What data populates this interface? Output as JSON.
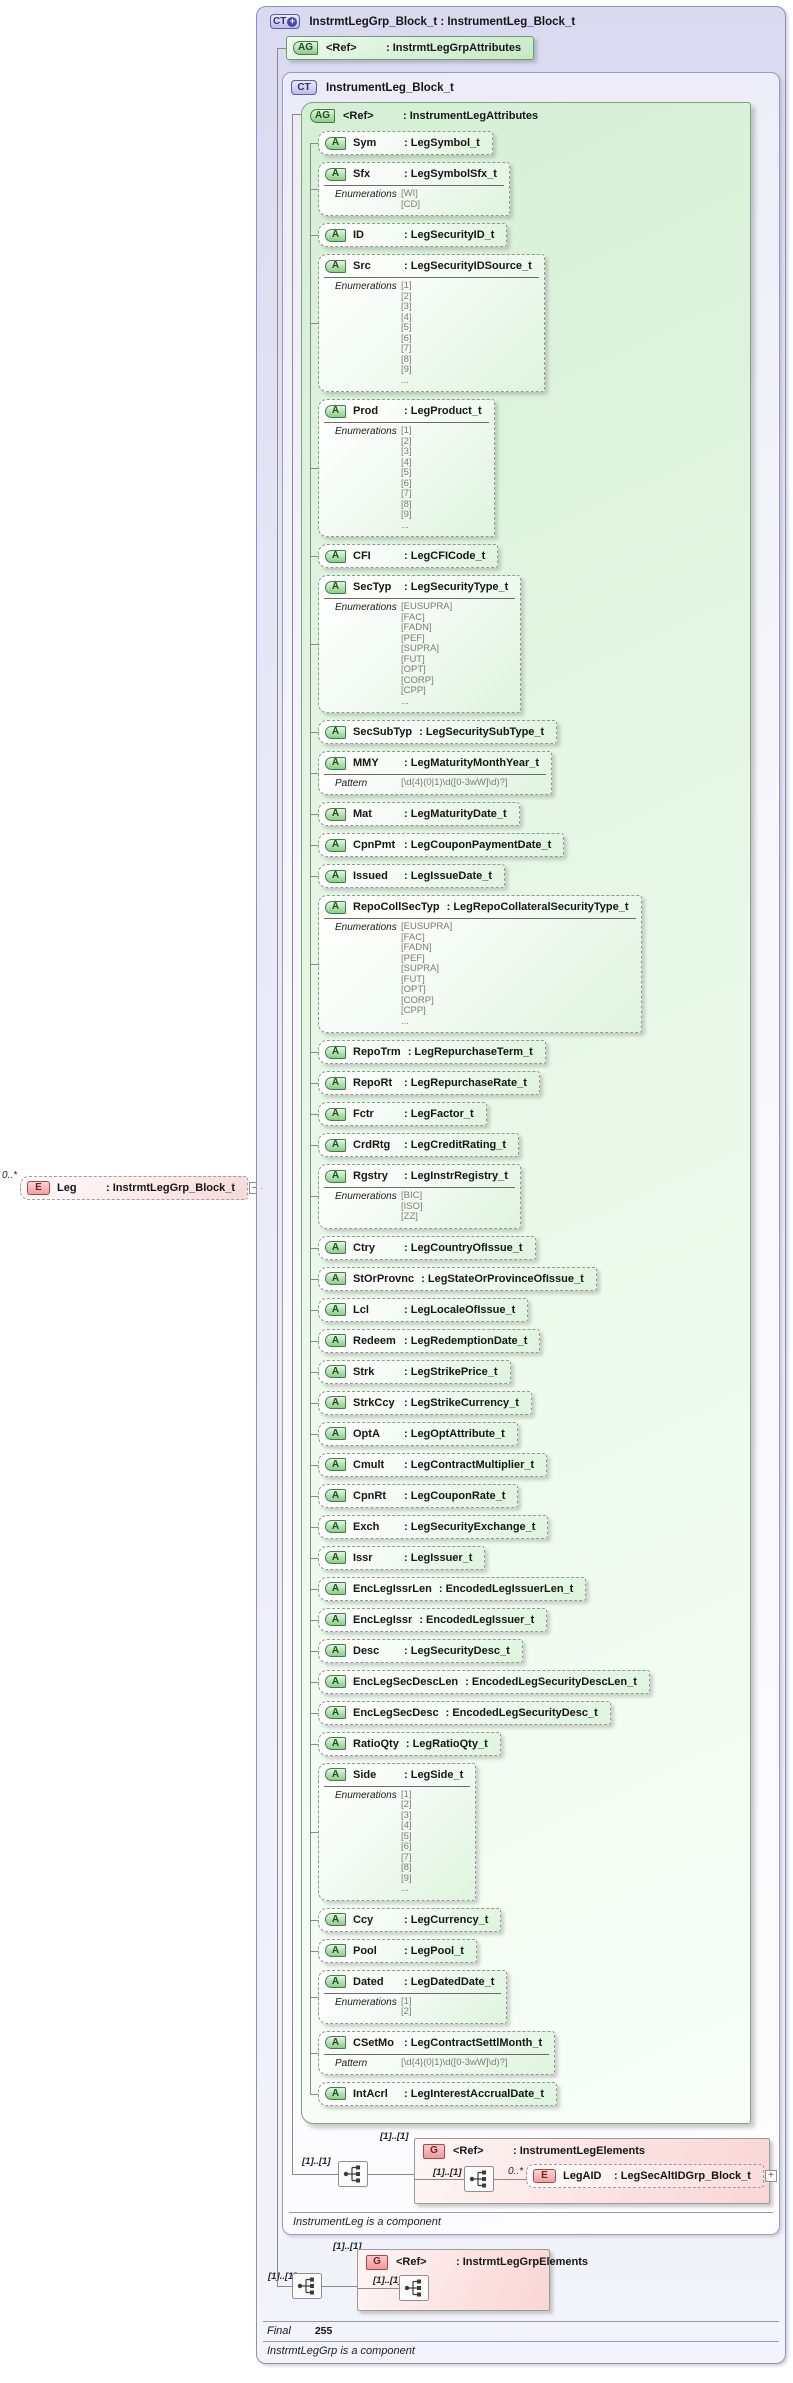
{
  "diagram": {
    "root": {
      "badge": "CT",
      "title": "InstrmtLegGrp_Block_t : InstrumentLeg_Block_t"
    },
    "labels": {
      "enumerations": "Enumerations",
      "pattern": "Pattern"
    },
    "outer_ag": {
      "badge": "AG",
      "ref": "<Ref>",
      "type": ": InstrmtLegGrpAttributes"
    },
    "ct": {
      "badge": "CT",
      "title": "InstrumentLeg_Block_t",
      "footer": "InstrumentLeg is a component"
    },
    "inner_ag": {
      "badge": "AG",
      "ref": "<Ref>",
      "type": ": InstrumentLegAttributes"
    },
    "leg": {
      "cardinality": "0..*",
      "badge": "E",
      "name": "Leg",
      "type": ": InstrmtLegGrp_Block_t",
      "collapse_glyph": "–"
    },
    "attributes": [
      {
        "badge": "A",
        "name": "Sym",
        "type": ": LegSymbol_t"
      },
      {
        "badge": "A",
        "name": "Sfx",
        "type": ": LegSymbolSfx_t",
        "enums": [
          "[WI]",
          "[CD]"
        ]
      },
      {
        "badge": "A",
        "name": "ID",
        "type": ": LegSecurityID_t"
      },
      {
        "badge": "A",
        "name": "Src",
        "type": ": LegSecurityIDSource_t",
        "enums": [
          "[1]",
          "[2]",
          "[3]",
          "[4]",
          "[5]",
          "[6]",
          "[7]",
          "[8]",
          "[9]",
          "..."
        ]
      },
      {
        "badge": "A",
        "name": "Prod",
        "type": ": LegProduct_t",
        "enums": [
          "[1]",
          "[2]",
          "[3]",
          "[4]",
          "[5]",
          "[6]",
          "[7]",
          "[8]",
          "[9]",
          "..."
        ]
      },
      {
        "badge": "A",
        "name": "CFI",
        "type": ": LegCFICode_t"
      },
      {
        "badge": "A",
        "name": "SecTyp",
        "type": ": LegSecurityType_t",
        "enums": [
          "[EUSUPRA]",
          "[FAC]",
          "[FADN]",
          "[PEF]",
          "[SUPRA]",
          "[FUT]",
          "[OPT]",
          "[CORP]",
          "[CPP]",
          "..."
        ]
      },
      {
        "badge": "A",
        "name": "SecSubTyp",
        "type": ": LegSecuritySubType_t"
      },
      {
        "badge": "A",
        "name": "MMY",
        "type": ": LegMaturityMonthYear_t",
        "pattern": "[\\d{4}(0|1)\\d([0-3wW]\\d)?]"
      },
      {
        "badge": "A",
        "name": "Mat",
        "type": ": LegMaturityDate_t"
      },
      {
        "badge": "A",
        "name": "CpnPmt",
        "type": ": LegCouponPaymentDate_t"
      },
      {
        "badge": "A",
        "name": "Issued",
        "type": ": LegIssueDate_t"
      },
      {
        "badge": "A",
        "name": "RepoCollSecTyp",
        "type": ": LegRepoCollateralSecurityType_t",
        "enums": [
          "[EUSUPRA]",
          "[FAC]",
          "[FADN]",
          "[PEF]",
          "[SUPRA]",
          "[FUT]",
          "[OPT]",
          "[CORP]",
          "[CPP]",
          "..."
        ]
      },
      {
        "badge": "A",
        "name": "RepoTrm",
        "type": ": LegRepurchaseTerm_t"
      },
      {
        "badge": "A",
        "name": "RepoRt",
        "type": ": LegRepurchaseRate_t"
      },
      {
        "badge": "A",
        "name": "Fctr",
        "type": ": LegFactor_t"
      },
      {
        "badge": "A",
        "name": "CrdRtg",
        "type": ": LegCreditRating_t"
      },
      {
        "badge": "A",
        "name": "Rgstry",
        "type": ": LegInstrRegistry_t",
        "enums": [
          "[BIC]",
          "[ISO]",
          "[ZZ]"
        ]
      },
      {
        "badge": "A",
        "name": "Ctry",
        "type": ": LegCountryOfIssue_t"
      },
      {
        "badge": "A",
        "name": "StOrProvnc",
        "type": ": LegStateOrProvinceOfIssue_t"
      },
      {
        "badge": "A",
        "name": "Lcl",
        "type": ": LegLocaleOfIssue_t"
      },
      {
        "badge": "A",
        "name": "Redeem",
        "type": ": LegRedemptionDate_t"
      },
      {
        "badge": "A",
        "name": "Strk",
        "type": ": LegStrikePrice_t"
      },
      {
        "badge": "A",
        "name": "StrkCcy",
        "type": ": LegStrikeCurrency_t"
      },
      {
        "badge": "A",
        "name": "OptA",
        "type": ": LegOptAttribute_t"
      },
      {
        "badge": "A",
        "name": "Cmult",
        "type": ": LegContractMultiplier_t"
      },
      {
        "badge": "A",
        "name": "CpnRt",
        "type": ": LegCouponRate_t"
      },
      {
        "badge": "A",
        "name": "Exch",
        "type": ": LegSecurityExchange_t"
      },
      {
        "badge": "A",
        "name": "Issr",
        "type": ": LegIssuer_t"
      },
      {
        "badge": "A",
        "name": "EncLegIssrLen",
        "type": ": EncodedLegIssuerLen_t"
      },
      {
        "badge": "A",
        "name": "EncLegIssr",
        "type": ": EncodedLegIssuer_t"
      },
      {
        "badge": "A",
        "name": "Desc",
        "type": ": LegSecurityDesc_t"
      },
      {
        "badge": "A",
        "name": "EncLegSecDescLen",
        "type": ": EncodedLegSecurityDescLen_t"
      },
      {
        "badge": "A",
        "name": "EncLegSecDesc",
        "type": ": EncodedLegSecurityDesc_t"
      },
      {
        "badge": "A",
        "name": "RatioQty",
        "type": ": LegRatioQty_t"
      },
      {
        "badge": "A",
        "name": "Side",
        "type": ": LegSide_t",
        "enums": [
          "[1]",
          "[2]",
          "[3]",
          "[4]",
          "[5]",
          "[6]",
          "[7]",
          "[8]",
          "[9]",
          "..."
        ]
      },
      {
        "badge": "A",
        "name": "Ccy",
        "type": ": LegCurrency_t"
      },
      {
        "badge": "A",
        "name": "Pool",
        "type": ": LegPool_t"
      },
      {
        "badge": "A",
        "name": "Dated",
        "type": ": LegDatedDate_t",
        "enums": [
          "[1]",
          "[2]"
        ]
      },
      {
        "badge": "A",
        "name": "CSetMo",
        "type": ": LegContractSettlMonth_t",
        "pattern": "[\\d{4}(0|1)\\d([0-3wW]\\d)?]"
      },
      {
        "badge": "A",
        "name": "IntAcrl",
        "type": ": LegInterestAccrualDate_t"
      }
    ],
    "leg_elements": {
      "cardinality_top": "[1]..[1]",
      "cardinality_left": "[1]..[1]",
      "badge": "G",
      "ref": "<Ref>",
      "type": ": InstrumentLegElements",
      "cardinality_inner": "[1]..[1]",
      "child_cardinality": "0..*",
      "child": {
        "badge": "E",
        "name": "LegAID",
        "type": ": LegSecAltIDGrp_Block_t",
        "expand_glyph": "+"
      }
    },
    "grp_elements": {
      "cardinality_top": "[1]..[1]",
      "cardinality_left": "[1]..[1]",
      "badge": "G",
      "ref": "<Ref>",
      "type": ": InstrmtLegGrpElements",
      "cardinality_inner": "[1]..[1]"
    },
    "footer": {
      "final_label": "Final",
      "final_value": "255",
      "note": "InstrmtLegGrp is a component"
    }
  }
}
